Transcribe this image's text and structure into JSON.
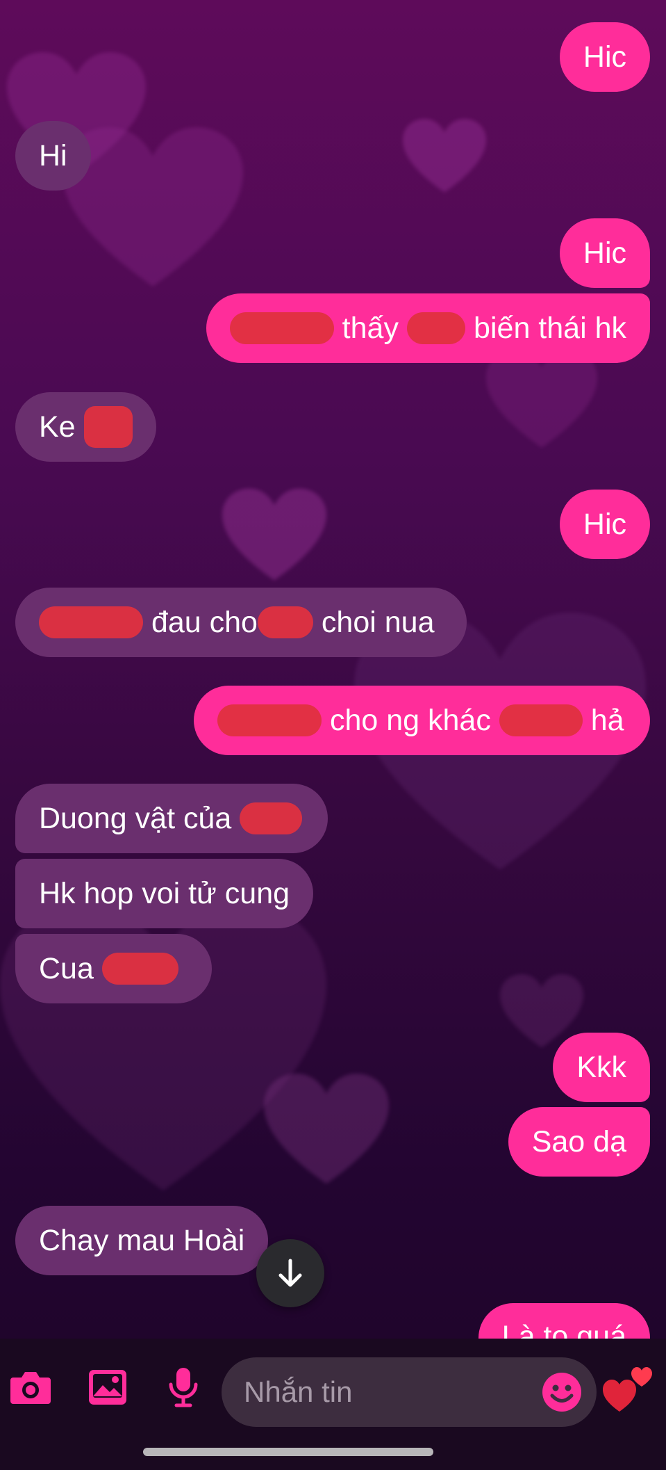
{
  "colors": {
    "outgoing_bubble": "#ff2d9a",
    "incoming_bubble": "#6a2f6e",
    "accent": "#ff2d9a",
    "redaction": "#e0303f"
  },
  "messages": [
    {
      "dir": "out",
      "text": "Hic"
    },
    {
      "dir": "in",
      "text": "Hi"
    },
    {
      "dir": "out",
      "text": "Hic"
    },
    {
      "dir": "out",
      "text_after": " thấy ",
      "text_end": " biến thái hk"
    },
    {
      "dir": "in",
      "text": "Ke "
    },
    {
      "dir": "out",
      "text": "Hic"
    },
    {
      "dir": "in",
      "text_mid": " đau cho",
      "text_end": " choi nua"
    },
    {
      "dir": "out",
      "text_mid": " cho ng khác ",
      "text_end": " hả"
    },
    {
      "dir": "in",
      "text": "Duong vật của "
    },
    {
      "dir": "in",
      "text": "Hk hop voi tử cung"
    },
    {
      "dir": "in",
      "text": "Cua "
    },
    {
      "dir": "out",
      "text": "Kkk"
    },
    {
      "dir": "out",
      "text": "Sao dạ"
    },
    {
      "dir": "in",
      "text": "Chay mau Hoài"
    },
    {
      "dir": "out",
      "text": "Là to quá"
    }
  ],
  "composer": {
    "placeholder": "Nhắn tin"
  },
  "icons": {
    "camera": "camera-icon",
    "gallery": "image-icon",
    "mic": "microphone-icon",
    "emoji": "emoji-icon",
    "like": "hearts-icon",
    "scroll": "arrow-down-icon"
  }
}
